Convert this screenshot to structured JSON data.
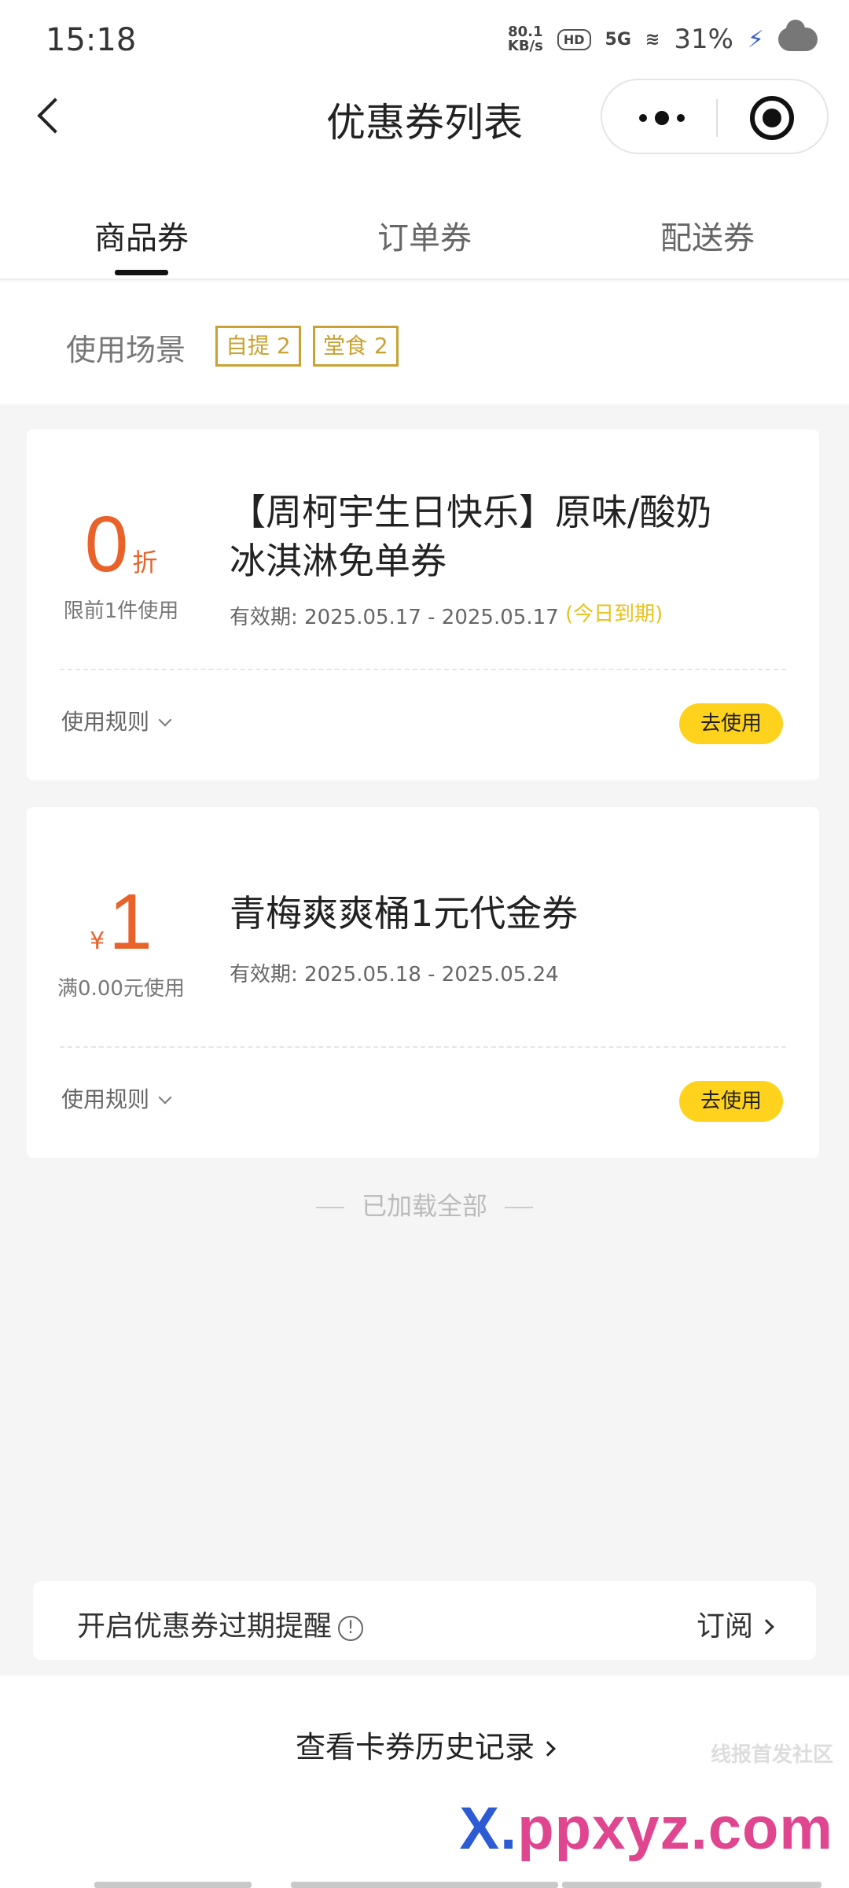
{
  "status_bar": {
    "time": "15:18",
    "net_speed": "80.1",
    "net_unit": "KB/s",
    "hd_badge": "HD",
    "signal": "5G",
    "battery": "31%",
    "icons": [
      "hd-icon",
      "signal-5g-icon",
      "wifi-icon",
      "charging-bolt-icon",
      "cloud-icon"
    ]
  },
  "nav": {
    "title": "优惠券列表"
  },
  "tabs": [
    {
      "label": "商品券",
      "active": true
    },
    {
      "label": "订单券",
      "active": false
    },
    {
      "label": "配送券",
      "active": false
    }
  ],
  "scene": {
    "label": "使用场景",
    "tags": [
      "自提 2",
      "堂食 2"
    ]
  },
  "coupons": [
    {
      "value": "0",
      "unit": "折",
      "condition": "限前1件使用",
      "title": "【周柯宇生日快乐】原味/酸奶冰淇淋免单券",
      "validity": "有效期: 2025.05.17 - 2025.05.17",
      "expire_tag": "(今日到期)",
      "rules_label": "使用规则",
      "button_label": "去使用"
    },
    {
      "value": "1",
      "unit": "¥",
      "condition": "满0.00元使用",
      "title": "青梅爽爽桶1元代金券",
      "validity": "有效期: 2025.05.18 - 2025.05.24",
      "expire_tag": "",
      "rules_label": "使用规则",
      "button_label": "去使用"
    }
  ],
  "loaded_text": "已加载全部",
  "reminder": {
    "text": "开启优惠券过期提醒",
    "info_glyph": "!",
    "action": "订阅"
  },
  "history_link": "查看卡券历史记录",
  "watermark": {
    "line1": "线报首发社区",
    "brand_prefix": "X.",
    "brand_rest": "ppxyz.com"
  },
  "colors": {
    "accent_orange": "#e8622a",
    "button_yellow": "#ffd21e",
    "tag_gold": "#c9a233",
    "expire_yellow": "#e8c21f"
  }
}
